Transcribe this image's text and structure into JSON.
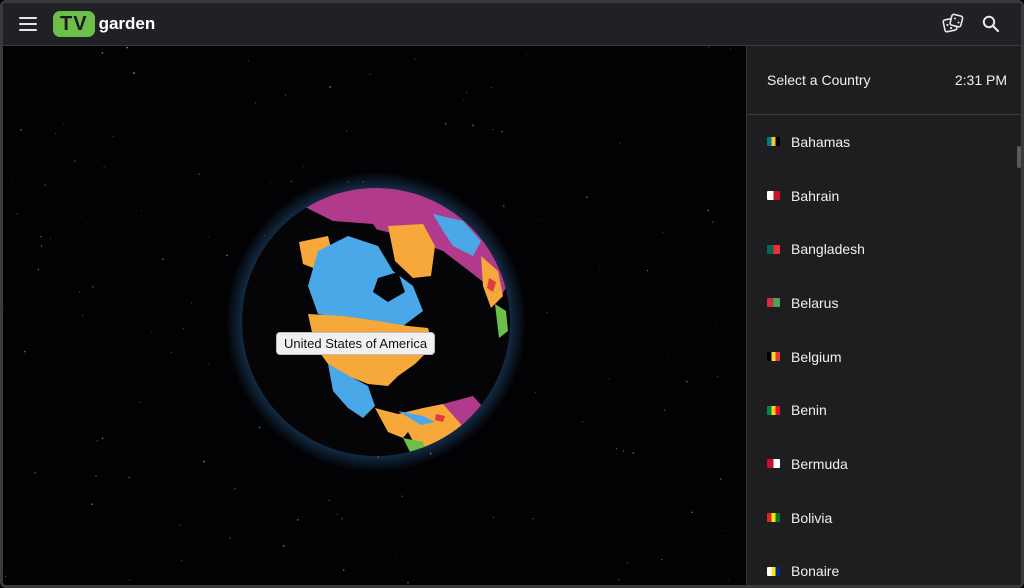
{
  "app": {
    "logo_tv": "TV",
    "logo_garden": "garden"
  },
  "toolbar": {
    "menu_icon": "hamburger-menu-icon",
    "random_icon": "dice-icon",
    "search_icon": "search-icon"
  },
  "globe": {
    "hovered_country": "United States of America"
  },
  "sidebar": {
    "title": "Select a Country",
    "time": "2:31 PM",
    "countries": [
      {
        "name": "Bahamas",
        "flag_colors": [
          "#00778b",
          "#ffc72c",
          "#000000"
        ]
      },
      {
        "name": "Bahrain",
        "flag_colors": [
          "#ffffff",
          "#ce1126"
        ]
      },
      {
        "name": "Bangladesh",
        "flag_colors": [
          "#006a4e",
          "#f42a41"
        ]
      },
      {
        "name": "Belarus",
        "flag_colors": [
          "#c8313e",
          "#4aa657"
        ]
      },
      {
        "name": "Belgium",
        "flag_colors": [
          "#000000",
          "#fdda24",
          "#ef3340"
        ]
      },
      {
        "name": "Benin",
        "flag_colors": [
          "#008751",
          "#fcd116",
          "#e8112d"
        ]
      },
      {
        "name": "Bermuda",
        "flag_colors": [
          "#c8102e",
          "#ffffff"
        ]
      },
      {
        "name": "Bolivia",
        "flag_colors": [
          "#d52b1e",
          "#f9e300",
          "#007934"
        ]
      },
      {
        "name": "Bonaire",
        "flag_colors": [
          "#ffffff",
          "#f9e814",
          "#012a87"
        ]
      }
    ]
  },
  "colors": {
    "accent": "#6cc04a",
    "land_orange": "#f7a83a",
    "land_blue": "#4aa8e8",
    "land_pink": "#b23a8c",
    "ocean": "#0a0a0c"
  }
}
